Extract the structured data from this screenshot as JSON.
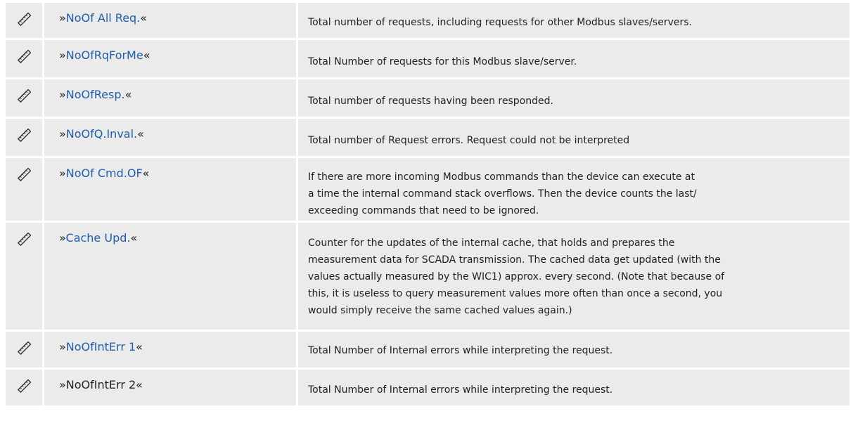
{
  "rows": [
    {
      "icon": "ruler-pencil-icon",
      "prefix": "»",
      "name": "NoOf All Req.",
      "suffix": "«",
      "link": true,
      "desc": "Total number of requests, including requests for other Modbus slaves/servers."
    },
    {
      "icon": "ruler-pencil-icon",
      "prefix": "»",
      "name": "NoOfRqForMe",
      "suffix": "«",
      "link": true,
      "desc": "Total Number of requests for this Modbus slave/server."
    },
    {
      "icon": "ruler-pencil-icon",
      "prefix": "»",
      "name": "NoOfResp.",
      "suffix": "«",
      "link": true,
      "desc": "Total number of requests having been responded."
    },
    {
      "icon": "ruler-pencil-icon",
      "prefix": "»",
      "name": "NoOfQ.Inval.",
      "suffix": "«",
      "link": true,
      "desc": "Total number of Request errors. Request could not be interpreted"
    },
    {
      "icon": "ruler-pencil-icon",
      "prefix": "»",
      "name": "NoOf Cmd.OF",
      "suffix": "«",
      "link": true,
      "desc_lines": [
        "If there are more incoming Modbus commands than the device can execute at",
        "a time the internal command stack overflows. Then the device counts the last/",
        "exceeding commands that need to be ignored."
      ]
    },
    {
      "icon": "ruler-pencil-icon",
      "prefix": "»",
      "name": "Cache Upd.",
      "suffix": "«",
      "link": true,
      "desc_lines": [
        "Counter for the updates of the internal cache, that holds and prepares the",
        "measurement data for SCADA transmission. The cached data get updated (with the",
        "values actually measured by the WIC1) approx. every second. (Note that because of",
        "this, it is useless to query measurement values more often than once a second, you",
        "would simply receive the same cached values again.)"
      ]
    },
    {
      "icon": "ruler-pencil-icon",
      "prefix": "»",
      "name": "NoOfIntErr 1",
      "suffix": "«",
      "link": true,
      "desc": "Total Number of Internal errors while interpreting the request."
    },
    {
      "icon": "ruler-pencil-icon",
      "prefix": "»",
      "name": "NoOfIntErr 2",
      "suffix": "«",
      "link": false,
      "desc": "Total Number of Internal errors while interpreting the request."
    }
  ],
  "colors": {
    "link": "#1f5ea8",
    "cell_bg": "#ebebeb",
    "text": "#222222"
  }
}
